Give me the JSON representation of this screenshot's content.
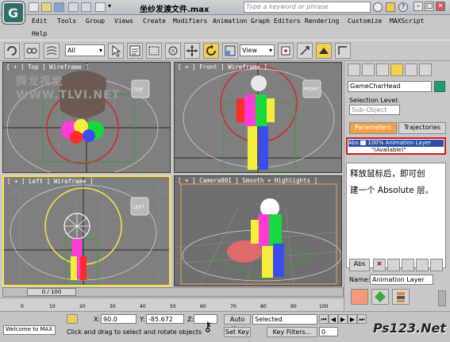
{
  "window": {
    "title": "坐纱发渡文件.max",
    "search_placeholder": "Type a keyword or phrase",
    "minimize": "–",
    "maximize": "□",
    "close": "✕"
  },
  "app_logo_letter": "G",
  "menu": {
    "items": [
      "Edit",
      "Tools",
      "Group",
      "Views",
      "Create",
      "Modifiers",
      "Animation",
      "Graph Editors",
      "Rendering",
      "Customize",
      "MAXScript",
      "Help"
    ]
  },
  "toolbar": {
    "filter_value": "All",
    "refcoord_value": "View"
  },
  "viewports": {
    "top_label": "[ + ] Top ] Wireframe ]",
    "front_label": "[ + ] Front ] Wireframe ]",
    "left_label": "[ + ] Left ] Wireframe ]",
    "camera_label": "[ + ] Camera001 ] Smooth + Highlights ]",
    "watermark": "腾龙视觉 WWW.TLVI.NET",
    "top_cube": "TOP",
    "front_cube": "FRONT",
    "left_cube": "LEFT"
  },
  "command_panel": {
    "object_name": "GameCharHead",
    "object_color": "#1a9e7a",
    "selection_level_label": "Selection Level:",
    "sub_object_value": "Sub-Object",
    "tab_parameters": "Parameters",
    "tab_trajectories": "Trajectories",
    "layer_row_text": "100% Animation Layer",
    "layer_row_prefix": "Abs",
    "layer_available": "\"(Available)\"",
    "tooltip_line1": "释放鼠标后，即可创",
    "tooltip_line2": "建一个 Absolute 层。",
    "abs_button": "Abs",
    "name_label": "Name:",
    "name_value": "Animation Layer"
  },
  "timeline": {
    "frame_counter": "0 / 100",
    "ticks": [
      "0",
      "10",
      "20",
      "30",
      "40",
      "50",
      "60",
      "70",
      "80",
      "90",
      "100"
    ]
  },
  "status": {
    "listener_text": "Welcome to MAX",
    "x_label": "X:",
    "x_value": "90.0",
    "y_label": "Y:",
    "y_value": "-85.672",
    "z_label": "Z:",
    "auto_key": "Auto Key",
    "set_key": "Set Key",
    "key_mode_value": "Selected",
    "key_filters": "Key Filters...",
    "prompt": "Click and drag to select and rotate objects",
    "frame_value": "0",
    "brand": "Ps123.Net"
  },
  "colors": {
    "accent_orange": "#f0a04a",
    "highlight_yellow": "#ffe24a",
    "tooltip_border": "#d01c1c"
  }
}
